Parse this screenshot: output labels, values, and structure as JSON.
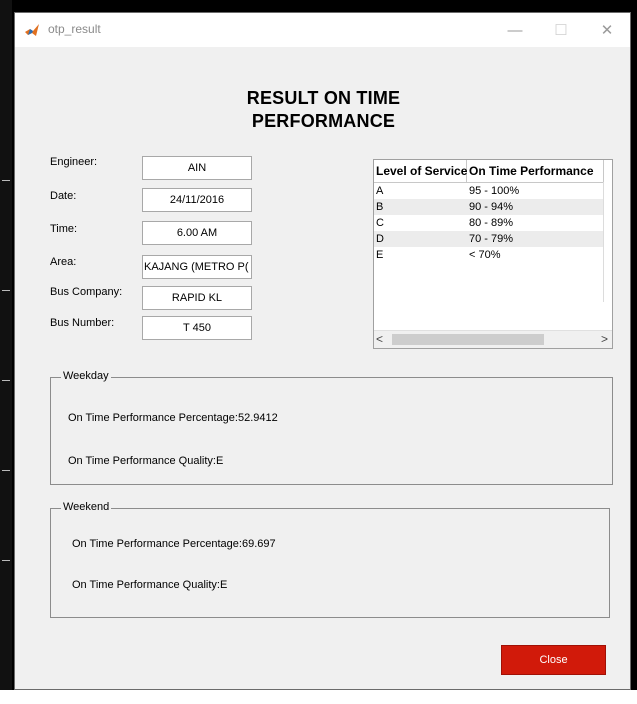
{
  "window": {
    "title": "otp_result"
  },
  "titlebar": {
    "minimize_glyph": "—",
    "maximize_glyph": "☐",
    "close_glyph": "✕"
  },
  "heading": {
    "line1": "RESULT ON TIME",
    "line2": "PERFORMANCE"
  },
  "form": {
    "engineer_label": "Engineer:",
    "engineer_value": "AIN",
    "date_label": "Date:",
    "date_value": "24/11/2016",
    "time_label": "Time:",
    "time_value": "6.00 AM",
    "area_label": "Area:",
    "area_value": "KAJANG (METRO P(",
    "company_label": "Bus Company:",
    "company_value": "RAPID KL",
    "number_label": "Bus Number:",
    "number_value": "T 450"
  },
  "table": {
    "headers": [
      "Level of Service",
      "On Time Performance"
    ],
    "rows": [
      [
        "A",
        "95 - 100%"
      ],
      [
        "B",
        "90 - 94%"
      ],
      [
        "C",
        "80 - 89%"
      ],
      [
        "D",
        "70 - 79%"
      ],
      [
        "E",
        "< 70%"
      ]
    ],
    "scroll_left": "<",
    "scroll_right": ">"
  },
  "weekday": {
    "title": "Weekday",
    "percentage": "On Time Performance Percentage:52.9412",
    "quality": "On Time Performance Quality:E"
  },
  "weekend": {
    "title": "Weekend",
    "percentage": "On Time Performance Percentage:69.697",
    "quality": "On Time Performance Quality:E"
  },
  "close_button": {
    "label": "Close"
  },
  "colors": {
    "close_button_bg": "#d11a0a",
    "window_bg": "#f0f0f0"
  },
  "icons": {
    "app": "matlab-icon"
  }
}
